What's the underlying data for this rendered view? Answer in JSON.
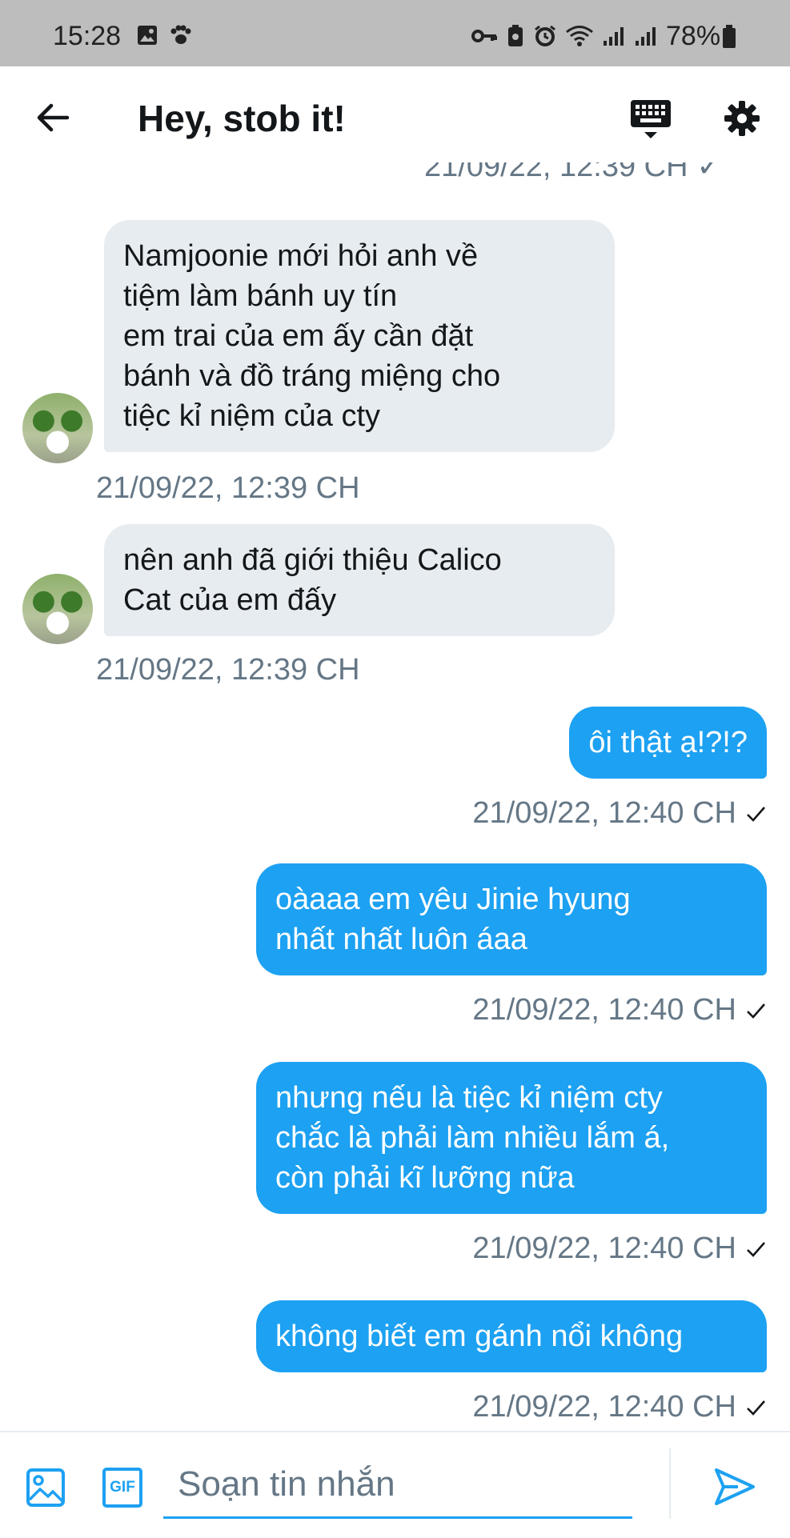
{
  "status_bar": {
    "time": "15:28",
    "battery": "78%"
  },
  "header": {
    "title": "Hey, stob it!"
  },
  "conversation": {
    "clipped_timestamp": "21/09/22, 12:39 CH ✓",
    "messages": [
      {
        "direction": "in",
        "lines": [
          "Namjoonie mới hỏi anh về",
          "tiệm làm bánh uy tín",
          "em trai của em ấy cần đặt",
          "bánh và đồ tráng miệng cho",
          "tiệc kỉ niệm của cty"
        ],
        "timestamp": "21/09/22, 12:39 CH"
      },
      {
        "direction": "in",
        "lines": [
          "nên anh đã giới thiệu Calico",
          "Cat của em đấy"
        ],
        "timestamp": "21/09/22, 12:39 CH"
      },
      {
        "direction": "out",
        "lines": [
          "ôi thật ạ!?!?"
        ],
        "timestamp": "21/09/22, 12:40 CH"
      },
      {
        "direction": "out",
        "lines": [
          "oàaaa em yêu Jinie hyung",
          "nhất nhất luôn áaa"
        ],
        "timestamp": "21/09/22, 12:40 CH"
      },
      {
        "direction": "out",
        "lines": [
          "nhưng nếu là tiệc kỉ niệm cty",
          "chắc là phải làm nhiều lắm á,",
          "còn phải kĩ lưỡng nữa"
        ],
        "timestamp": "21/09/22, 12:40 CH"
      },
      {
        "direction": "out",
        "lines": [
          "không biết em gánh nổi không"
        ],
        "timestamp": "21/09/22, 12:40 CH"
      }
    ]
  },
  "composer": {
    "placeholder": "Soạn tin nhắn",
    "gif_label": "GIF"
  },
  "colors": {
    "accent": "#1da1f2",
    "incoming_bubble": "#e6ecf0",
    "timestamp": "#657786",
    "status_bar": "#bdbdbd"
  },
  "icons": {
    "back": "arrow-left-icon",
    "keyboard": "keyboard-icon",
    "settings": "gear-icon",
    "image": "image-icon",
    "gif": "gif-icon",
    "send": "send-icon"
  }
}
